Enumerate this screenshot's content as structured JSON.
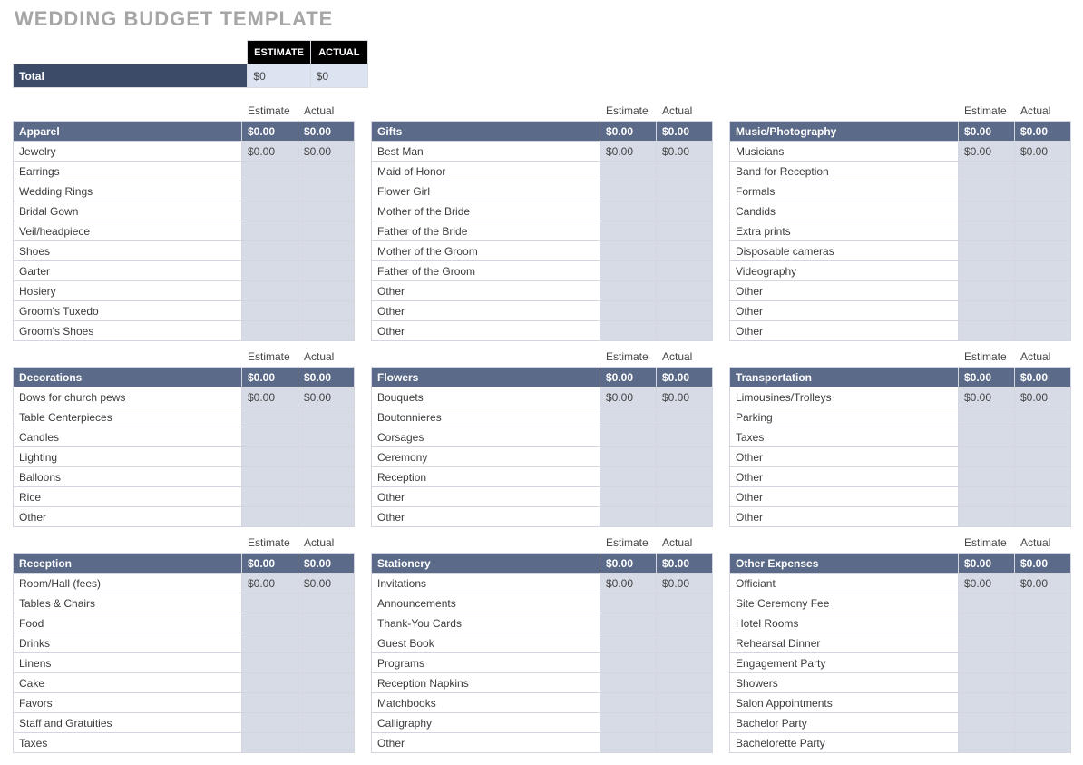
{
  "title": "WEDDING BUDGET TEMPLATE",
  "summary": {
    "est_header": "ESTIMATE",
    "act_header": "ACTUAL",
    "total_label": "Total",
    "total_estimate": "$0",
    "total_actual": "$0"
  },
  "section_headers": {
    "estimate": "Estimate",
    "actual": "Actual"
  },
  "sections": [
    {
      "name": "Apparel",
      "estimate": "$0.00",
      "actual": "$0.00",
      "rows": [
        {
          "name": "Jewelry",
          "estimate": "$0.00",
          "actual": "$0.00"
        },
        {
          "name": "Earrings",
          "estimate": "",
          "actual": ""
        },
        {
          "name": "Wedding Rings",
          "estimate": "",
          "actual": ""
        },
        {
          "name": "Bridal Gown",
          "estimate": "",
          "actual": ""
        },
        {
          "name": "Veil/headpiece",
          "estimate": "",
          "actual": ""
        },
        {
          "name": "Shoes",
          "estimate": "",
          "actual": ""
        },
        {
          "name": "Garter",
          "estimate": "",
          "actual": ""
        },
        {
          "name": "Hosiery",
          "estimate": "",
          "actual": ""
        },
        {
          "name": "Groom's Tuxedo",
          "estimate": "",
          "actual": ""
        },
        {
          "name": "Groom's Shoes",
          "estimate": "",
          "actual": ""
        }
      ]
    },
    {
      "name": "Gifts",
      "estimate": "$0.00",
      "actual": "$0.00",
      "rows": [
        {
          "name": "Best Man",
          "estimate": "$0.00",
          "actual": "$0.00"
        },
        {
          "name": "Maid of Honor",
          "estimate": "",
          "actual": ""
        },
        {
          "name": "Flower Girl",
          "estimate": "",
          "actual": ""
        },
        {
          "name": "Mother of the Bride",
          "estimate": "",
          "actual": ""
        },
        {
          "name": "Father of the Bride",
          "estimate": "",
          "actual": ""
        },
        {
          "name": "Mother of the Groom",
          "estimate": "",
          "actual": ""
        },
        {
          "name": "Father of the Groom",
          "estimate": "",
          "actual": ""
        },
        {
          "name": "Other",
          "estimate": "",
          "actual": ""
        },
        {
          "name": "Other",
          "estimate": "",
          "actual": ""
        },
        {
          "name": "Other",
          "estimate": "",
          "actual": ""
        }
      ]
    },
    {
      "name": "Music/Photography",
      "estimate": "$0.00",
      "actual": "$0.00",
      "rows": [
        {
          "name": "Musicians",
          "estimate": "$0.00",
          "actual": "$0.00"
        },
        {
          "name": "Band for Reception",
          "estimate": "",
          "actual": ""
        },
        {
          "name": "Formals",
          "estimate": "",
          "actual": ""
        },
        {
          "name": "Candids",
          "estimate": "",
          "actual": ""
        },
        {
          "name": "Extra prints",
          "estimate": "",
          "actual": ""
        },
        {
          "name": "Disposable cameras",
          "estimate": "",
          "actual": ""
        },
        {
          "name": "Videography",
          "estimate": "",
          "actual": ""
        },
        {
          "name": "Other",
          "estimate": "",
          "actual": ""
        },
        {
          "name": "Other",
          "estimate": "",
          "actual": ""
        },
        {
          "name": "Other",
          "estimate": "",
          "actual": ""
        }
      ]
    },
    {
      "name": "Decorations",
      "estimate": "$0.00",
      "actual": "$0.00",
      "rows": [
        {
          "name": "Bows for church pews",
          "estimate": "$0.00",
          "actual": "$0.00"
        },
        {
          "name": "Table Centerpieces",
          "estimate": "",
          "actual": ""
        },
        {
          "name": "Candles",
          "estimate": "",
          "actual": ""
        },
        {
          "name": "Lighting",
          "estimate": "",
          "actual": ""
        },
        {
          "name": "Balloons",
          "estimate": "",
          "actual": ""
        },
        {
          "name": "Rice",
          "estimate": "",
          "actual": ""
        },
        {
          "name": "Other",
          "estimate": "",
          "actual": ""
        }
      ]
    },
    {
      "name": "Flowers",
      "estimate": "$0.00",
      "actual": "$0.00",
      "rows": [
        {
          "name": "Bouquets",
          "estimate": "$0.00",
          "actual": "$0.00"
        },
        {
          "name": "Boutonnieres",
          "estimate": "",
          "actual": ""
        },
        {
          "name": "Corsages",
          "estimate": "",
          "actual": ""
        },
        {
          "name": "Ceremony",
          "estimate": "",
          "actual": ""
        },
        {
          "name": "Reception",
          "estimate": "",
          "actual": ""
        },
        {
          "name": "Other",
          "estimate": "",
          "actual": ""
        },
        {
          "name": "Other",
          "estimate": "",
          "actual": ""
        }
      ]
    },
    {
      "name": "Transportation",
      "estimate": "$0.00",
      "actual": "$0.00",
      "rows": [
        {
          "name": "Limousines/Trolleys",
          "estimate": "$0.00",
          "actual": "$0.00"
        },
        {
          "name": "Parking",
          "estimate": "",
          "actual": ""
        },
        {
          "name": "Taxes",
          "estimate": "",
          "actual": ""
        },
        {
          "name": "Other",
          "estimate": "",
          "actual": ""
        },
        {
          "name": "Other",
          "estimate": "",
          "actual": ""
        },
        {
          "name": "Other",
          "estimate": "",
          "actual": ""
        },
        {
          "name": "Other",
          "estimate": "",
          "actual": ""
        }
      ]
    },
    {
      "name": "Reception",
      "estimate": "$0.00",
      "actual": "$0.00",
      "rows": [
        {
          "name": "Room/Hall (fees)",
          "estimate": "$0.00",
          "actual": "$0.00"
        },
        {
          "name": "Tables & Chairs",
          "estimate": "",
          "actual": ""
        },
        {
          "name": "Food",
          "estimate": "",
          "actual": ""
        },
        {
          "name": "Drinks",
          "estimate": "",
          "actual": ""
        },
        {
          "name": "Linens",
          "estimate": "",
          "actual": ""
        },
        {
          "name": "Cake",
          "estimate": "",
          "actual": ""
        },
        {
          "name": "Favors",
          "estimate": "",
          "actual": ""
        },
        {
          "name": "Staff and Gratuities",
          "estimate": "",
          "actual": ""
        },
        {
          "name": "Taxes",
          "estimate": "",
          "actual": ""
        }
      ]
    },
    {
      "name": "Stationery",
      "estimate": "$0.00",
      "actual": "$0.00",
      "rows": [
        {
          "name": "Invitations",
          "estimate": "$0.00",
          "actual": "$0.00"
        },
        {
          "name": "Announcements",
          "estimate": "",
          "actual": ""
        },
        {
          "name": "Thank-You Cards",
          "estimate": "",
          "actual": ""
        },
        {
          "name": "Guest Book",
          "estimate": "",
          "actual": ""
        },
        {
          "name": "Programs",
          "estimate": "",
          "actual": ""
        },
        {
          "name": "Reception Napkins",
          "estimate": "",
          "actual": ""
        },
        {
          "name": "Matchbooks",
          "estimate": "",
          "actual": ""
        },
        {
          "name": "Calligraphy",
          "estimate": "",
          "actual": ""
        },
        {
          "name": "Other",
          "estimate": "",
          "actual": ""
        }
      ]
    },
    {
      "name": "Other Expenses",
      "estimate": "$0.00",
      "actual": "$0.00",
      "rows": [
        {
          "name": "Officiant",
          "estimate": "$0.00",
          "actual": "$0.00"
        },
        {
          "name": "Site Ceremony Fee",
          "estimate": "",
          "actual": ""
        },
        {
          "name": "Hotel Rooms",
          "estimate": "",
          "actual": ""
        },
        {
          "name": "Rehearsal Dinner",
          "estimate": "",
          "actual": ""
        },
        {
          "name": "Engagement Party",
          "estimate": "",
          "actual": ""
        },
        {
          "name": "Showers",
          "estimate": "",
          "actual": ""
        },
        {
          "name": "Salon Appointments",
          "estimate": "",
          "actual": ""
        },
        {
          "name": "Bachelor Party",
          "estimate": "",
          "actual": ""
        },
        {
          "name": "Bachelorette Party",
          "estimate": "",
          "actual": ""
        }
      ]
    }
  ]
}
